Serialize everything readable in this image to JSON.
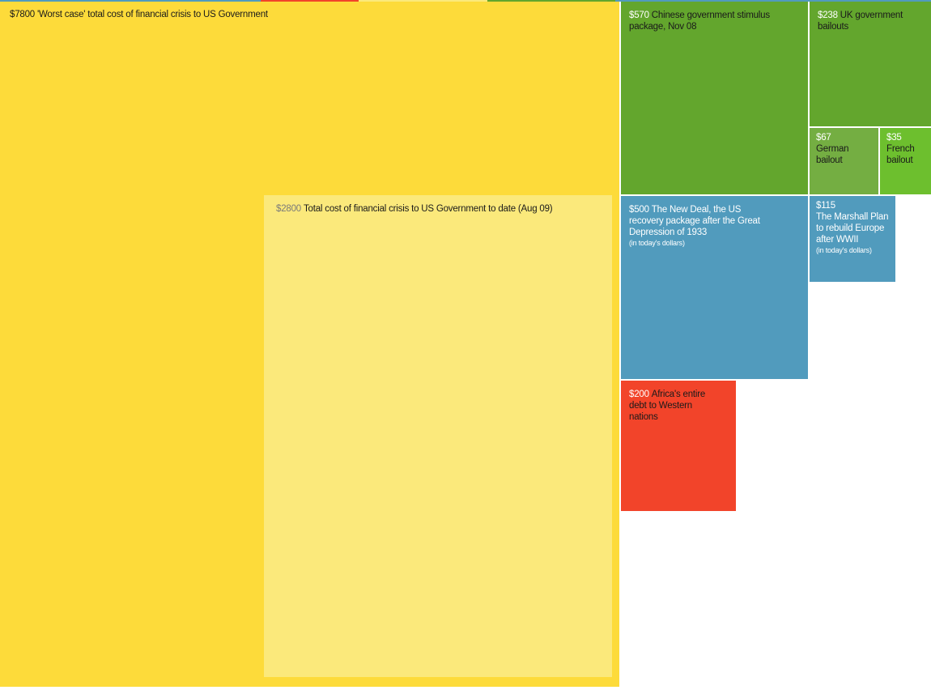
{
  "chart_data": {
    "type": "treemap",
    "title": "",
    "unit": "$",
    "items": [
      {
        "id": "worst-case-us",
        "value": 7800,
        "value_label": "$7800",
        "label": "'Worst case' total cost of financial crisis to US Government",
        "note": "",
        "color": "#fddb3a",
        "value_color": "#1a1a1a",
        "text_color": "#1a1a1a"
      },
      {
        "id": "us-to-date",
        "value": 2800,
        "value_label": "$2800",
        "label": "Total cost of financial crisis to US Government to date (Aug 09)",
        "note": "",
        "color": "#fbe97b",
        "value_color": "#7a7a7a",
        "text_color": "#1a1a1a"
      },
      {
        "id": "china-stimulus",
        "value": 570,
        "value_label": "$570",
        "label": "Chinese government stimulus package, Nov 08",
        "note": "",
        "color": "#63a62d",
        "value_color": "#ffffff",
        "text_color": "#1a1a1a"
      },
      {
        "id": "uk-bailouts",
        "value": 238,
        "value_label": "$238",
        "label": "UK government bailouts",
        "note": "",
        "color": "#63a62d",
        "value_color": "#ffffff",
        "text_color": "#1a1a1a"
      },
      {
        "id": "german-bailout",
        "value": 67,
        "value_label": "$67",
        "label": "German bailout",
        "note": "",
        "color": "#74ae42",
        "value_color": "#ffffff",
        "text_color": "#1a1a1a"
      },
      {
        "id": "french-bailout",
        "value": 35,
        "value_label": "$35",
        "label": "French bailout",
        "note": "",
        "color": "#6dbf2e",
        "value_color": "#ffffff",
        "text_color": "#1a1a1a"
      },
      {
        "id": "new-deal",
        "value": 500,
        "value_label": "$500",
        "label": "The New Deal, the US recovery package after the Great Depression of 1933",
        "note": "(in today's dollars)",
        "color": "#519bbd",
        "value_color": "#ffffff",
        "text_color": "#ffffff"
      },
      {
        "id": "marshall-plan",
        "value": 115,
        "value_label": "$115",
        "label": "The Marshall Plan to rebuild Europe after WWII",
        "note": "(in today's dollars)",
        "color": "#519bbd",
        "value_color": "#ffffff",
        "text_color": "#ffffff"
      },
      {
        "id": "africa-debt",
        "value": 200,
        "value_label": "$200",
        "label": "Africa's entire debt to Western nations",
        "note": "",
        "color": "#f2442a",
        "value_color": "#ffffff",
        "text_color": "#1a1a1a"
      }
    ],
    "top_strip_colors": [
      "#519bbd",
      "#f2442a",
      "#fbe97b",
      "#63a62d",
      "#519bbd"
    ]
  }
}
